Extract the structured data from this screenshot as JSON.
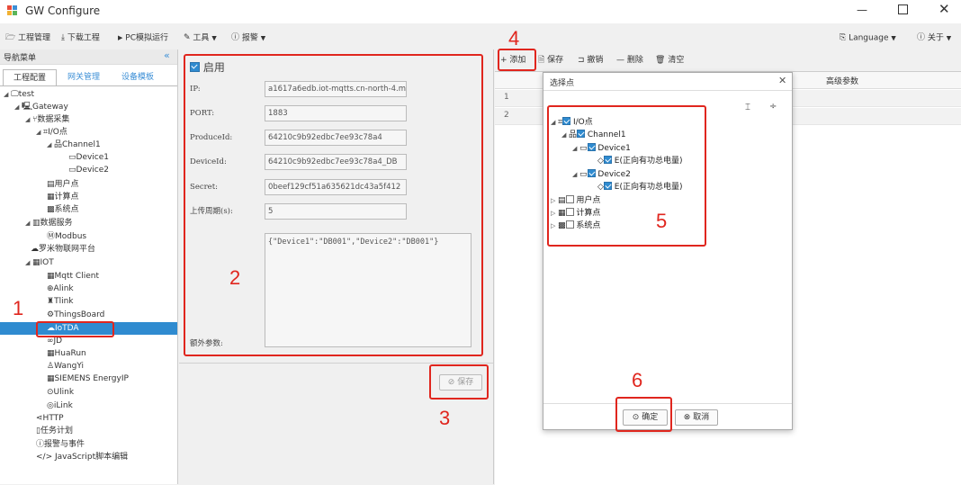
{
  "window": {
    "title": "GW Configure"
  },
  "menu": {
    "project": "工程管理",
    "download": "下载工程",
    "pc_run": "PC模拟运行",
    "tools": "工具",
    "alarm": "报警",
    "language": "Language",
    "about": "关于"
  },
  "nav": {
    "header": "导航菜单",
    "tabs": [
      "工程配置",
      "网关管理",
      "设备模板"
    ],
    "tree": {
      "test": "test",
      "gateway": "Gateway",
      "collect": "数据采集",
      "io": "I/O点",
      "channel1": "Channel1",
      "device1": "Device1",
      "device2": "Device2",
      "user_points": "用户点",
      "calc_points": "计算点",
      "sys_points": "系统点",
      "data_service": "数据服务",
      "modbus": "Modbus",
      "luomi": "罗米物联网平台",
      "iot": "IOT",
      "mqtt": "Mqtt Client",
      "alink": "Alink",
      "tlink": "Tlink",
      "thingsboard": "ThingsBoard",
      "iotda": "IoTDA",
      "jd": "JD",
      "huarun": "HuaRun",
      "wangyi": "WangYi",
      "siemens": "SIEMENS EnergyIP",
      "ulink": "Ulink",
      "ilink": "iLink",
      "http": "HTTP",
      "task": "任务计划",
      "alarm_event": "报警与事件",
      "js_editor": "JavaScript脚本编辑"
    }
  },
  "form": {
    "enable_label": "启用",
    "fields": [
      {
        "label": "IP:",
        "value": "a1617a6edb.iot-mqtts.cn-north-4.m"
      },
      {
        "label": "PORT:",
        "value": "1883"
      },
      {
        "label": "ProduceId:",
        "value": "64210c9b92edbc7ee93c78a4"
      },
      {
        "label": "DeviceId:",
        "value": "64210c9b92edbc7ee93c78a4_DB"
      },
      {
        "label": "Secret:",
        "value": "0beef129cf51a635621dc43a5f412"
      },
      {
        "label": "上传周期(s):",
        "value": "5"
      }
    ],
    "extra_label": "额外参数:",
    "extra_value": "{\"Device1\":\"DB001\",\"Device2\":\"DB001\"}",
    "save_button": "保存"
  },
  "toolbar": {
    "add": "添加",
    "save": "保存",
    "undo": "撤销",
    "delete": "删除",
    "clear": "清空"
  },
  "grid": {
    "column_adv": "高级参数",
    "rows": [
      "1",
      "2"
    ]
  },
  "dialog": {
    "title": "选择点",
    "tree": {
      "io": "I/O点",
      "channel1": "Channel1",
      "device1": "Device1",
      "e1": "E(正向有功总电量)",
      "device2": "Device2",
      "e2": "E(正向有功总电量)",
      "user": "用户点",
      "calc": "计算点",
      "sys": "系统点"
    },
    "ok": "确定",
    "cancel": "取消"
  },
  "annotations": [
    "1",
    "2",
    "3",
    "4",
    "5",
    "6"
  ],
  "colors": {
    "accent": "#2f8bd0",
    "selected_row": "#2f8bd0",
    "annotation": "#e0261e"
  }
}
